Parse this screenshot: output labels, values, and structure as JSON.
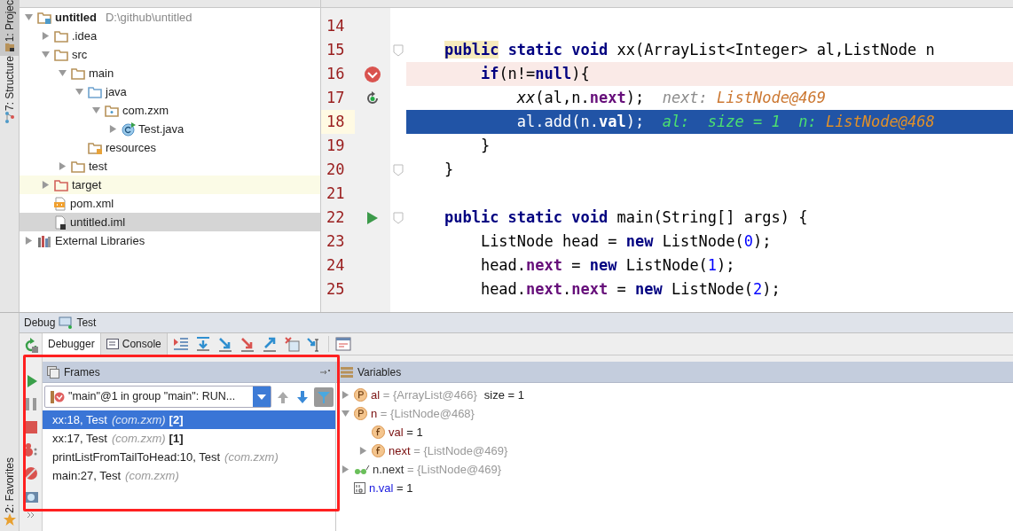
{
  "side_tabs": [
    {
      "label": "1: Projec",
      "selected": true
    },
    {
      "label": "7: Structure",
      "selected": false
    }
  ],
  "bottom_side_tabs": [
    {
      "label": "2: Favorites",
      "selected": false
    }
  ],
  "project_tree": [
    {
      "name": "untitled",
      "path": "D:\\github\\untitled",
      "kind": "module",
      "expanded": true,
      "selected": false,
      "children": [
        {
          "name": ".idea",
          "kind": "folder",
          "expanded": false,
          "selected": false
        },
        {
          "name": "src",
          "kind": "folder",
          "expanded": true,
          "selected": false,
          "children": [
            {
              "name": "main",
              "kind": "folder",
              "expanded": true,
              "selected": false,
              "children": [
                {
                  "name": "java",
                  "kind": "source-folder",
                  "expanded": true,
                  "selected": false,
                  "children": [
                    {
                      "name": "com.zxm",
                      "kind": "package",
                      "expanded": true,
                      "selected": false,
                      "children": [
                        {
                          "name": "Test.java",
                          "kind": "class",
                          "expanded": false,
                          "selected": false
                        }
                      ]
                    }
                  ]
                },
                {
                  "name": "resources",
                  "kind": "resources-folder",
                  "selected": false
                }
              ]
            },
            {
              "name": "test",
              "kind": "folder",
              "expanded": false,
              "selected": false
            }
          ]
        },
        {
          "name": "target",
          "kind": "excluded-folder",
          "expanded": false,
          "selected": false,
          "highlighted": true
        },
        {
          "name": "pom.xml",
          "kind": "xml",
          "selected": false
        },
        {
          "name": "untitled.iml",
          "kind": "iml",
          "selected": true
        }
      ]
    },
    {
      "name": "External Libraries",
      "kind": "library",
      "expanded": false,
      "selected": false
    }
  ],
  "editor": {
    "lines": [
      {
        "number": "14",
        "kind": "plain"
      },
      {
        "number": "15",
        "kind": "plain",
        "fold": true,
        "segments": [
          {
            "t": "    public",
            "kind": "kw-marked"
          },
          {
            "t": " static void",
            "kind": "kw"
          },
          {
            "t": " xx(ArrayList<Integer> al,ListNode n",
            "kind": "plain"
          }
        ]
      },
      {
        "number": "16",
        "kind": "breakpoint",
        "segments": [
          {
            "t": "        if",
            "kind": "kw"
          },
          {
            "t": "(n!=",
            "kind": "plain"
          },
          {
            "t": "null",
            "kind": "kw"
          },
          {
            "t": "){",
            "kind": "plain"
          }
        ]
      },
      {
        "number": "17",
        "kind": "frame",
        "segments": [
          {
            "t": "            xx",
            "kind": "italic"
          },
          {
            "t": "(al,n.",
            "kind": "plain"
          },
          {
            "t": "next",
            "kind": "field"
          },
          {
            "t": ");",
            "kind": "plain"
          },
          {
            "t": "  next:",
            "kind": "hint-label"
          },
          {
            "t": " ListNode@469",
            "kind": "hint-value"
          }
        ]
      },
      {
        "number": "18",
        "kind": "execution",
        "segments": [
          {
            "t": "            al.add(n.",
            "kind": "plain"
          },
          {
            "t": "val",
            "kind": "field"
          },
          {
            "t": ");",
            "kind": "plain"
          },
          {
            "t": "  al:  size = 1  n:",
            "kind": "hint-label"
          },
          {
            "t": " ListNode@468",
            "kind": "hint-value"
          }
        ]
      },
      {
        "number": "19",
        "kind": "plain",
        "segments": [
          {
            "t": "        }",
            "kind": "plain"
          }
        ]
      },
      {
        "number": "20",
        "kind": "plain",
        "fold": true,
        "segments": [
          {
            "t": "    }",
            "kind": "plain"
          }
        ]
      },
      {
        "number": "21",
        "kind": "plain"
      },
      {
        "number": "22",
        "kind": "run",
        "fold": true,
        "segments": [
          {
            "t": "    public static void",
            "kind": "kw"
          },
          {
            "t": " main(String[] args) {",
            "kind": "plain"
          }
        ]
      },
      {
        "number": "23",
        "kind": "plain",
        "segments": [
          {
            "t": "        ListNode head = ",
            "kind": "plain"
          },
          {
            "t": "new",
            "kind": "kw"
          },
          {
            "t": " ListNode(",
            "kind": "plain"
          },
          {
            "t": "0",
            "kind": "num"
          },
          {
            "t": ");",
            "kind": "plain"
          }
        ]
      },
      {
        "number": "24",
        "kind": "plain",
        "segments": [
          {
            "t": "        head.",
            "kind": "plain"
          },
          {
            "t": "next",
            "kind": "field"
          },
          {
            "t": " = ",
            "kind": "plain"
          },
          {
            "t": "new",
            "kind": "kw"
          },
          {
            "t": " ListNode(",
            "kind": "plain"
          },
          {
            "t": "1",
            "kind": "num"
          },
          {
            "t": ");",
            "kind": "plain"
          }
        ]
      },
      {
        "number": "25",
        "kind": "plain",
        "segments": [
          {
            "t": "        head.",
            "kind": "plain"
          },
          {
            "t": "next",
            "kind": "field"
          },
          {
            "t": ".",
            "kind": "plain"
          },
          {
            "t": "next",
            "kind": "field"
          },
          {
            "t": " = ",
            "kind": "plain"
          },
          {
            "t": "new",
            "kind": "kw"
          },
          {
            "t": " ListNode(",
            "kind": "plain"
          },
          {
            "t": "2",
            "kind": "num"
          },
          {
            "t": ");",
            "kind": "plain"
          }
        ]
      }
    ]
  },
  "debug": {
    "title": "Debug",
    "config": "Test",
    "tabs": [
      {
        "label": "Debugger",
        "selected": true
      },
      {
        "label": "Console",
        "selected": false
      }
    ],
    "frames": {
      "title": "Frames",
      "thread": "\"main\"@1 in group \"main\": RUN...",
      "items": [
        {
          "method": "xx:18, Test",
          "package": "(com.zxm)",
          "depth": "[2]",
          "selected": true
        },
        {
          "method": "xx:17, Test",
          "package": "(com.zxm)",
          "depth": "[1]",
          "selected": false
        },
        {
          "method": "printListFromTailToHead:10, Test",
          "package": "(com.zxm)",
          "selected": false
        },
        {
          "method": "main:27, Test",
          "package": "(com.zxm)",
          "selected": false
        }
      ]
    },
    "variables": {
      "title": "Variables",
      "items": [
        {
          "kind": "param",
          "name": "al",
          "value": "= {ArrayList@466}",
          "extra": "size = 1",
          "expanded": false
        },
        {
          "kind": "param",
          "name": "n",
          "value": "= {ListNode@468}",
          "expanded": true,
          "children": [
            {
              "kind": "field",
              "name": "val",
              "value": "= 1"
            },
            {
              "kind": "field",
              "name": "next",
              "value": "= {ListNode@469}",
              "expanded": false
            }
          ]
        },
        {
          "kind": "watch",
          "name": "n.next",
          "value": "= {ListNode@469}",
          "expanded": false
        },
        {
          "kind": "primitive",
          "name": "n.val",
          "value": "= 1"
        }
      ]
    }
  }
}
